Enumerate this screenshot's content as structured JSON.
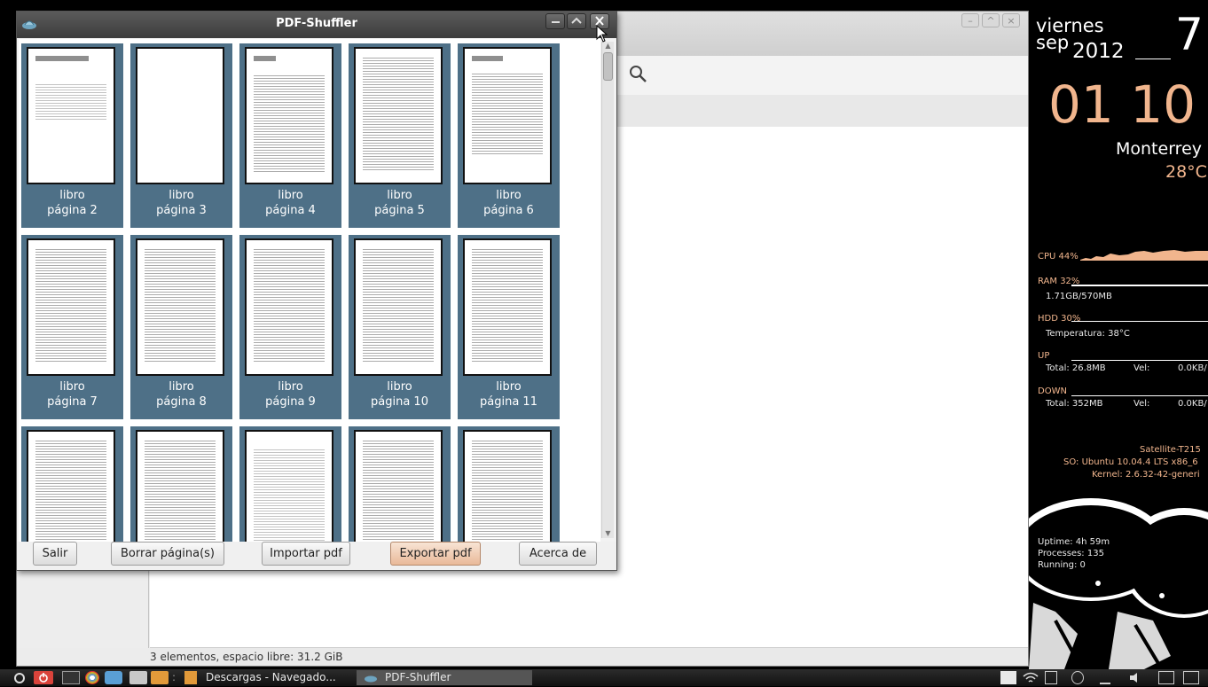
{
  "bg_window": {
    "status_text": "3 elementos, espacio libre: 31.2 GiB"
  },
  "pdf_window": {
    "title": "PDF-Shuffler",
    "pages": [
      {
        "name": "libro",
        "page": "página 2"
      },
      {
        "name": "libro",
        "page": "página 3"
      },
      {
        "name": "libro",
        "page": "página 4"
      },
      {
        "name": "libro",
        "page": "página 5"
      },
      {
        "name": "libro",
        "page": "página 6"
      },
      {
        "name": "libro",
        "page": "página 7"
      },
      {
        "name": "libro",
        "page": "página 8"
      },
      {
        "name": "libro",
        "page": "página 9"
      },
      {
        "name": "libro",
        "page": "página 10"
      },
      {
        "name": "libro",
        "page": "página 11"
      },
      {
        "name": "",
        "page": ""
      },
      {
        "name": "",
        "page": ""
      },
      {
        "name": "",
        "page": ""
      },
      {
        "name": "",
        "page": ""
      },
      {
        "name": "",
        "page": ""
      }
    ],
    "buttons": {
      "quit": "Salir",
      "delete": "Borrar página(s)",
      "import": "Importar pdf",
      "export": "Exportar pdf",
      "about": "Acerca de"
    }
  },
  "conky": {
    "weekday": "viernes",
    "month": "sep",
    "year": "2012",
    "day": "7",
    "time": "01 10",
    "city": "Monterrey",
    "temperature": "28°C",
    "cpu": "CPU 44%",
    "ram": "RAM 32%",
    "ram_detail": "1.71GB/570MB",
    "hdd": "HDD 30%",
    "hdd_temp": "Temperatura: 38°C",
    "up": "UP",
    "up_total": "Total: 26.8MB",
    "up_vel_label": "Vel:",
    "up_vel": "0.0KB/",
    "down": "DOWN",
    "down_total": "Total: 352MB",
    "down_vel_label": "Vel:",
    "down_vel": "0.0KB/",
    "host": "Satellite-T215",
    "os": "SO: Ubuntu 10.04.4 LTS x86_6",
    "kernel": "Kernel: 2.6.32-42-generi",
    "uptime": "Uptime: 4h 59m",
    "processes": "Processes: 135",
    "running": "Running: 0",
    "accent": "#f1b58d"
  },
  "taskbar": {
    "task1": "Descargas - Navegado...",
    "task2": "PDF-Shuffler"
  }
}
